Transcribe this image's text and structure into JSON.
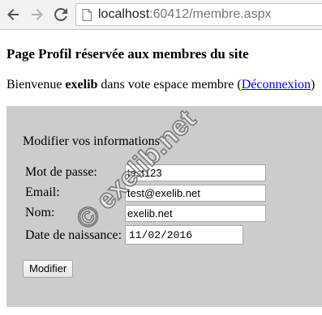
{
  "browser": {
    "url_host": "localhost",
    "url_path": ":60412/membre.aspx"
  },
  "page": {
    "title": "Page Profil réservée aux membres du site",
    "welcome_prefix": "Bienvenue ",
    "username": "exelib",
    "welcome_suffix": " dans vote espace membre (",
    "logout_link": "Déconnexion",
    "welcome_close": ")"
  },
  "form": {
    "title": "Modifier vos informations",
    "fields": [
      {
        "label": "Mot de passe:",
        "value": "test123"
      },
      {
        "label": "Email:",
        "value": "test@exelib.net"
      },
      {
        "label": "Nom:",
        "value": "exelib.net"
      },
      {
        "label": "Date de naissance:",
        "value": "11/02/2016"
      }
    ],
    "submit_label": "Modifier"
  },
  "watermark": {
    "text": "© exelib.net"
  },
  "colors": {
    "panel_bg": "#cccccc",
    "link": "#0000ee",
    "toolbar_bg": "#f2f2f2"
  }
}
